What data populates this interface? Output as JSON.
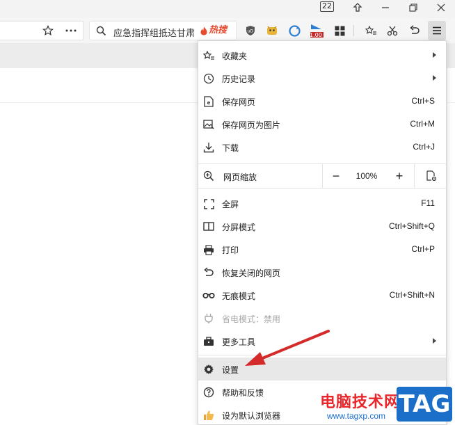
{
  "titlebar": {
    "tab_count": "22"
  },
  "toolbar": {
    "search_text": "应急指挥组抵达甘肃",
    "hot_label": "热搜",
    "ext_badge": "1.00"
  },
  "menu": {
    "favorites": "收藏夹",
    "history": "历史记录",
    "save_page": "保存网页",
    "save_page_sc": "Ctrl+S",
    "save_as_image": "保存网页为图片",
    "save_as_image_sc": "Ctrl+M",
    "download": "下载",
    "download_sc": "Ctrl+J",
    "zoom_label": "网页缩放",
    "zoom_minus": "−",
    "zoom_value": "100%",
    "zoom_plus": "+",
    "fullscreen": "全屏",
    "fullscreen_sc": "F11",
    "split_screen": "分屏模式",
    "split_screen_sc": "Ctrl+Shift+Q",
    "print": "打印",
    "print_sc": "Ctrl+P",
    "restore_closed": "恢复关闭的网页",
    "incognito": "无痕模式",
    "incognito_sc": "Ctrl+Shift+N",
    "power_saver": "省电模式：禁用",
    "more_tools": "更多工具",
    "settings": "设置",
    "help": "帮助和反馈",
    "default_browser": "设为默认浏览器"
  },
  "watermark": {
    "site_name": "电脑技术网",
    "site_url": "www.tagxp.com",
    "tag": "TAG"
  },
  "colors": {
    "accent_red": "#d42a2a",
    "hot_red": "#e84a2f",
    "watermark_blue": "#1c6fc9"
  }
}
